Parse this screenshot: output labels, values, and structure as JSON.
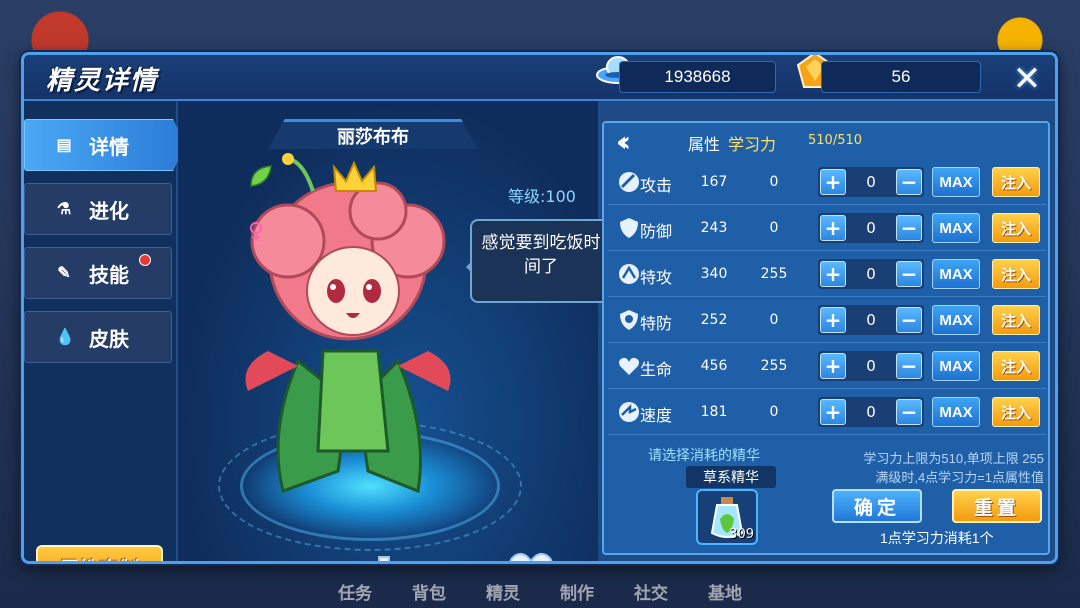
{
  "header": {
    "title": "精灵详情",
    "coins": "1938668",
    "gems": "56",
    "close_icon": "close-icon"
  },
  "sidebar": {
    "items": [
      {
        "label": "详情",
        "icon": "detail-icon",
        "active": true
      },
      {
        "label": "进化",
        "icon": "flask-icon",
        "active": false
      },
      {
        "label": "技能",
        "icon": "skill-icon",
        "active": false,
        "badge": true
      },
      {
        "label": "皮肤",
        "icon": "droplet-icon",
        "active": false
      }
    ],
    "counter_button": "属性克制"
  },
  "pet": {
    "name": "丽莎布布",
    "level_label": "等级:",
    "level": "100",
    "speech": "感觉要到吃饭时间了",
    "gender_symbol": "♀",
    "element_icon": "leaf-icon"
  },
  "stats": {
    "title": "属性",
    "subtitle": "学习力",
    "total": "510/510",
    "rows": [
      {
        "name": "攻击",
        "base": "167",
        "points": "0",
        "input": "0",
        "icon": "sword-icon"
      },
      {
        "name": "防御",
        "base": "243",
        "points": "0",
        "input": "0",
        "icon": "shield-icon"
      },
      {
        "name": "特攻",
        "base": "340",
        "points": "255",
        "input": "0",
        "icon": "special-attack-icon"
      },
      {
        "name": "特防",
        "base": "252",
        "points": "0",
        "input": "0",
        "icon": "special-defense-icon"
      },
      {
        "name": "生命",
        "base": "456",
        "points": "255",
        "input": "0",
        "icon": "heart-life-icon"
      },
      {
        "name": "速度",
        "base": "181",
        "points": "0",
        "input": "0",
        "icon": "speed-icon"
      }
    ],
    "max_label": "MAX",
    "inject_label": "注入",
    "plus": "+",
    "minus": "−",
    "essence_prompt": "请选择消耗的精华",
    "essence_name": "草系精华",
    "essence_count": "309",
    "limit_line1": "学习力上限为510,单项上限 255",
    "limit_line2": "满级时,4点学习力=1点属性值",
    "confirm_label": "确定",
    "reset_label": "重置",
    "cost_text": "1点学习力消耗1个"
  },
  "background": {
    "bottom_nav": [
      "任务",
      "背包",
      "精灵",
      "制作",
      "社交",
      "基地"
    ]
  }
}
